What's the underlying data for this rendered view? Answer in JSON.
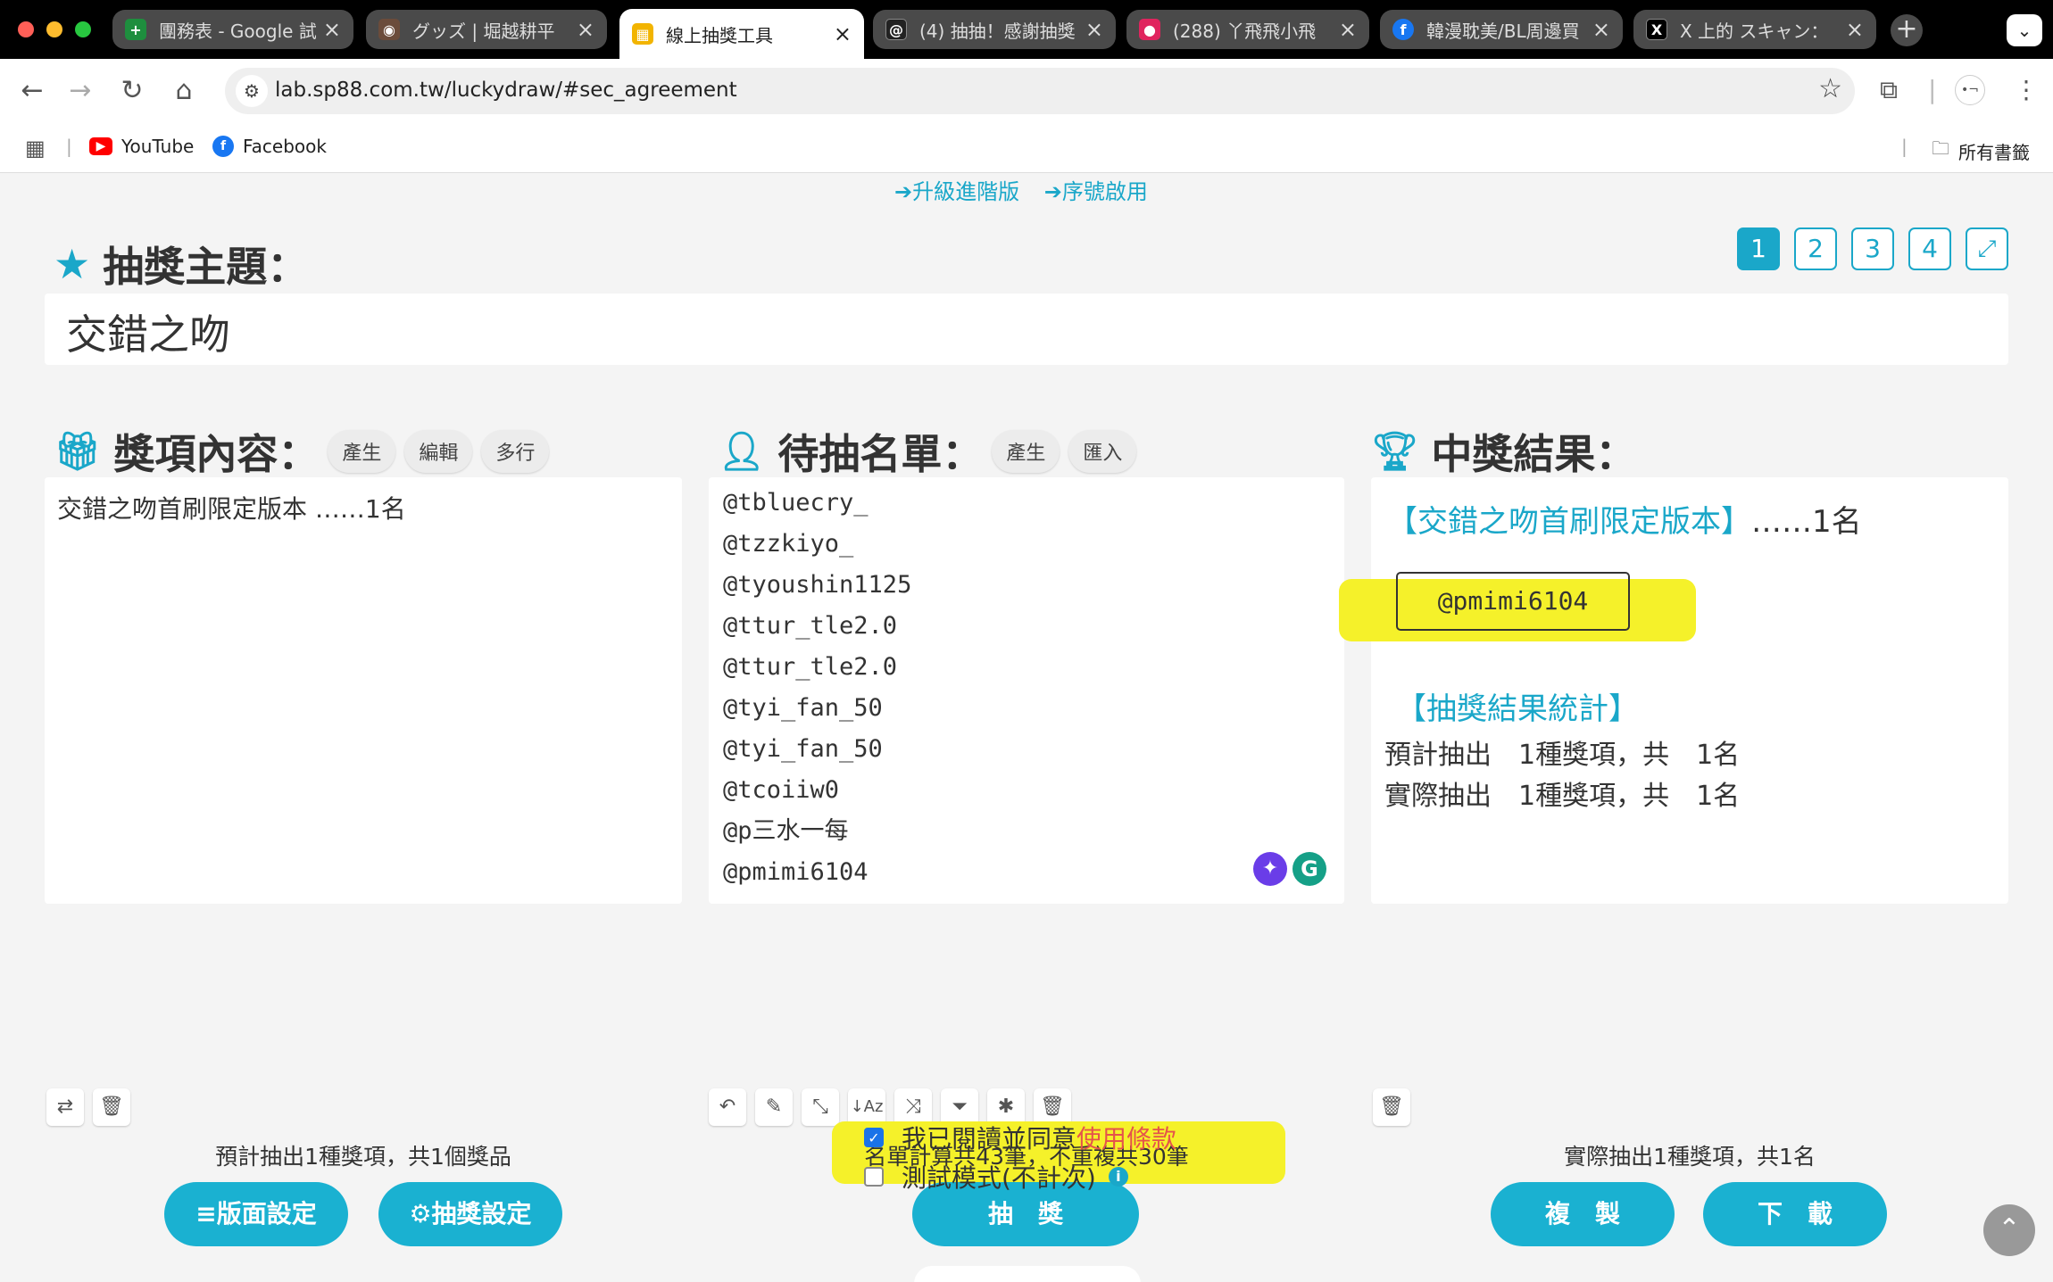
{
  "browser": {
    "tabs": [
      {
        "title": "團務表 - Google 試",
        "icon_color": "#1e8e3e",
        "icon_glyph": "+"
      },
      {
        "title": "グッズ | 堀越耕平",
        "icon_color": "#6b4c3b",
        "icon_glyph": "◉"
      },
      {
        "title": "線上抽獎工具",
        "icon_color": "#f2b400",
        "icon_glyph": "▦"
      },
      {
        "title": "(4) 抽抽！感謝抽獎",
        "icon_color": "#222222",
        "icon_glyph": "@"
      },
      {
        "title": "(288) 丫飛飛小飛",
        "icon_color": "#e0245e",
        "icon_glyph": "●"
      },
      {
        "title": "韓漫耽美/BL周邊買",
        "icon_color": "#1877f2",
        "icon_glyph": "f"
      },
      {
        "title": "X 上的 スキャン：",
        "icon_color": "#000000",
        "icon_glyph": "X"
      }
    ],
    "url": "lab.sp88.com.tw/luckydraw/#sec_agreement",
    "bookmarks": [
      {
        "label": "YouTube",
        "icon_color": "#ff0000",
        "icon_glyph": "▶"
      },
      {
        "label": "Facebook",
        "icon_color": "#1877f2",
        "icon_glyph": "f"
      }
    ],
    "all_bookmarks": "所有書籤"
  },
  "top_links": [
    "➔升級進階版",
    "➔序號啟用"
  ],
  "theme": {
    "label": "抽獎主題：",
    "value": "交錯之吻",
    "pages": [
      "1",
      "2",
      "3",
      "4"
    ],
    "expand_icon": "expand-icon"
  },
  "prizes": {
    "label": "獎項內容：",
    "buttons": [
      "產生",
      "編輯",
      "多行"
    ],
    "content": "交錯之吻首刷限定版本 ……1名",
    "summary": "預計抽出1種獎項，共1個獎品",
    "layout_btn": "≡版面設定",
    "draw_settings_btn": "⚙抽獎設定"
  },
  "entrants": {
    "label": "待抽名單：",
    "buttons": [
      "產生",
      "匯入"
    ],
    "names": [
      "@tbluecry_",
      "@tzzkiyo_",
      "@tyoushin1125",
      "@ttur_tle2.0",
      "@ttur_tle2.0",
      "@tyi_fan_50",
      "@tyi_fan_50",
      "@tcoiiw0",
      "@p三水一每",
      "@pmimi6104"
    ],
    "summary": "名單計算共43筆，不重複共30筆",
    "draw_btn": "抽　獎"
  },
  "results": {
    "label": "中獎結果：",
    "prize_title": "【交錯之吻首刷限定版本】",
    "prize_count": "……1名",
    "winner": "@pmimi6104",
    "stats_title": "【抽獎結果統計】",
    "stats": [
      "預計抽出　1種獎項，共　1名",
      "實際抽出　1種獎項，共　1名"
    ],
    "summary": "實際抽出1種獎項，共1名",
    "copy_btn": "複　製",
    "download_btn": "下　載"
  },
  "agreement": {
    "read_text": "我已閱讀並同意",
    "terms_link": "使用條款",
    "read_checked": true,
    "test_mode": "測試模式(不計次)",
    "test_checked": false
  },
  "colors": {
    "accent": "#1aa7c9",
    "button": "#1ab1d1",
    "highlight": "#f5f12a",
    "terms": "#e5534b"
  }
}
